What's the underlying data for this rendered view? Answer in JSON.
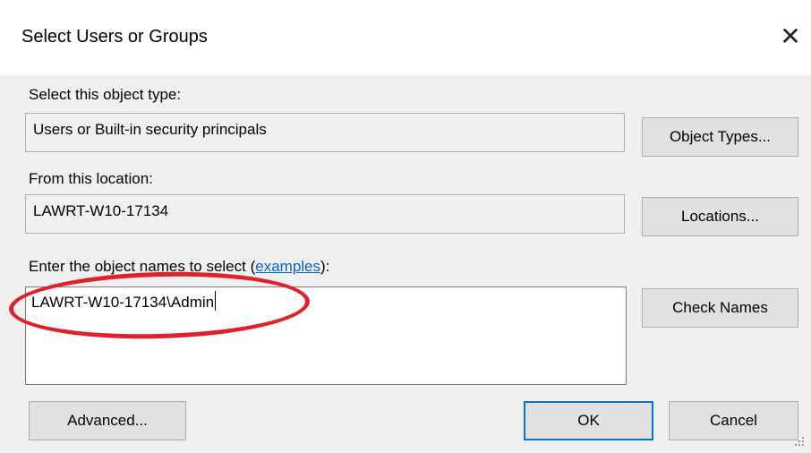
{
  "window": {
    "title": "Select Users or Groups",
    "close_icon": "close-icon"
  },
  "object_type": {
    "label": "Select this object type:",
    "value": "Users or Built-in security principals",
    "button": "Object Types..."
  },
  "location": {
    "label": "From this location:",
    "value": "LAWRT-W10-17134",
    "button": "Locations..."
  },
  "names": {
    "label_prefix": "Enter the object names to select (",
    "label_link": "examples",
    "label_suffix": "):",
    "value": "LAWRT-W10-17134\\Admin",
    "button": "Check Names"
  },
  "footer": {
    "advanced": "Advanced...",
    "ok": "OK",
    "cancel": "Cancel"
  },
  "colors": {
    "annotation": "#e0202a",
    "link": "#0066cc",
    "focus": "#0078d7"
  }
}
